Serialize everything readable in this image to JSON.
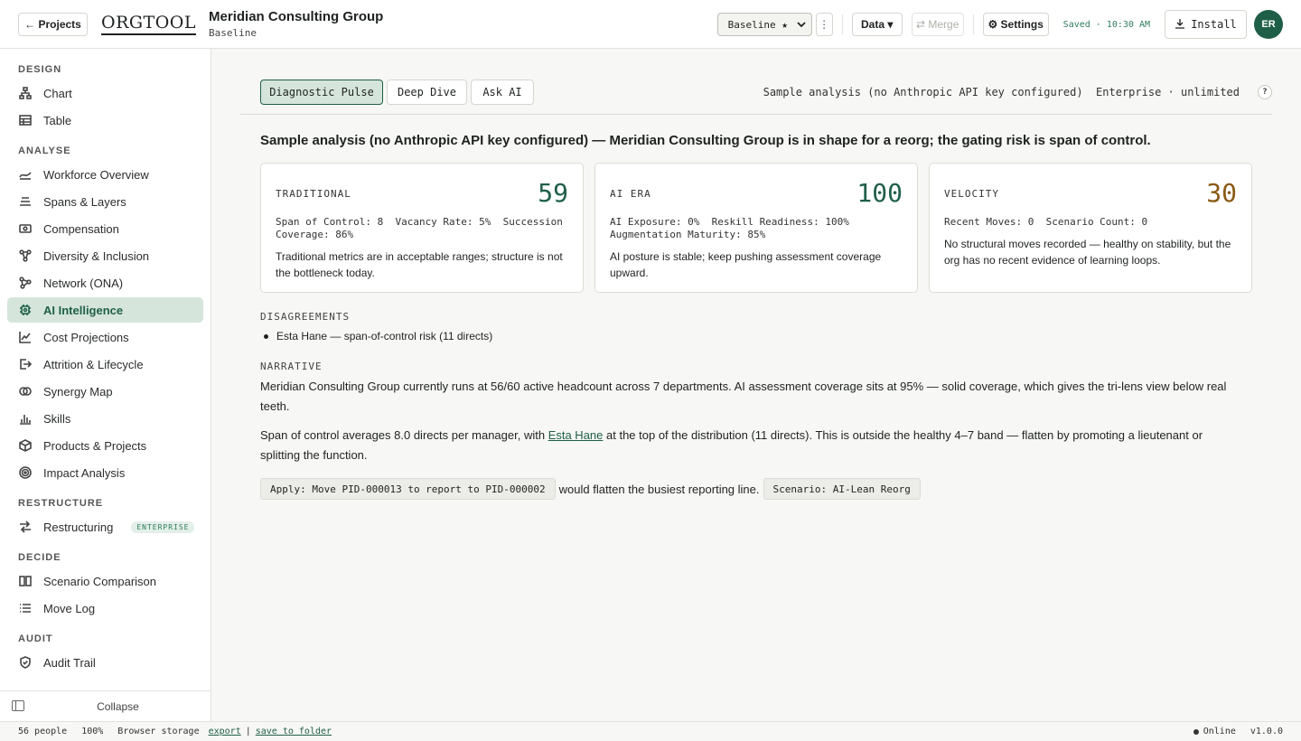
{
  "header": {
    "projects_label": "← Projects",
    "logo": "ORGTOOL",
    "org_name": "Meridian Consulting Group",
    "org_subtitle": "Baseline",
    "scenario_select": "Baseline ★",
    "kebab": "⋮",
    "data_label": "Data ▾",
    "merge_label": "⇄ Merge",
    "settings_label": "⚙ Settings",
    "saved_status": "Saved · 10:30 AM",
    "install_label": "Install",
    "avatar_initials": "ER"
  },
  "sidebar": {
    "sections": [
      {
        "label": "DESIGN",
        "items": [
          {
            "label": "Chart",
            "icon": "org-chart-icon"
          },
          {
            "label": "Table",
            "icon": "table-icon"
          }
        ]
      },
      {
        "label": "ANALYSE",
        "items": [
          {
            "label": "Workforce Overview",
            "icon": "trend-icon"
          },
          {
            "label": "Spans & Layers",
            "icon": "layers-icon"
          },
          {
            "label": "Compensation",
            "icon": "banknote-icon"
          },
          {
            "label": "Diversity & Inclusion",
            "icon": "people-icon"
          },
          {
            "label": "Network (ONA)",
            "icon": "network-icon"
          },
          {
            "label": "AI Intelligence",
            "icon": "chip-icon",
            "active": true
          },
          {
            "label": "Cost Projections",
            "icon": "line-chart-icon"
          },
          {
            "label": "Attrition & Lifecycle",
            "icon": "exit-icon"
          },
          {
            "label": "Synergy Map",
            "icon": "venn-icon"
          },
          {
            "label": "Skills",
            "icon": "bar-chart-icon"
          },
          {
            "label": "Products & Projects",
            "icon": "box-icon"
          },
          {
            "label": "Impact Analysis",
            "icon": "target-icon"
          }
        ]
      },
      {
        "label": "RESTRUCTURE",
        "items": [
          {
            "label": "Restructuring",
            "icon": "shuffle-icon",
            "badge": "ENTERPRISE"
          }
        ]
      },
      {
        "label": "DECIDE",
        "items": [
          {
            "label": "Scenario Comparison",
            "icon": "columns-icon"
          },
          {
            "label": "Move Log",
            "icon": "list-icon"
          }
        ]
      },
      {
        "label": "AUDIT",
        "items": [
          {
            "label": "Audit Trail",
            "icon": "shield-check-icon"
          }
        ]
      }
    ],
    "collapse_label": "Collapse"
  },
  "main": {
    "tabs": [
      {
        "label": "Diagnostic Pulse",
        "active": true
      },
      {
        "label": "Deep Dive"
      },
      {
        "label": "Ask AI"
      }
    ],
    "info_text": "Sample analysis (no Anthropic API key configured)  Enterprise · unlimited",
    "help": "?",
    "headline": "Sample analysis (no Anthropic API key configured) — Meridian Consulting Group is in shape for a reorg; the gating risk is span of control.",
    "cards": [
      {
        "label": "TRADITIONAL",
        "score": "59",
        "metrics": "Span of Control: 8  Vacancy Rate: 5%  Succession Coverage: 86%",
        "desc": "Traditional metrics are in acceptable ranges; structure is not the bottleneck today."
      },
      {
        "label": "AI ERA",
        "score": "100",
        "metrics": "AI Exposure: 0%  Reskill Readiness: 100%  Augmentation Maturity: 85%",
        "desc": "AI posture is stable; keep pushing assessment coverage upward."
      },
      {
        "label": "VELOCITY",
        "score": "30",
        "metrics": "Recent Moves: 0  Scenario Count: 0",
        "desc": "No structural moves recorded — healthy on stability, but the org has no recent evidence of learning loops."
      }
    ],
    "disagreements_label": "DISAGREEMENTS",
    "disagreements": [
      "Esta Hane — span-of-control risk (11 directs)"
    ],
    "narrative_label": "NARRATIVE",
    "narrative_1": "Meridian Consulting Group currently runs at 56/60 active headcount across 7 departments. AI assessment coverage sits at 95% — solid coverage, which gives the tri-lens view below real teeth.",
    "narrative_2_pre": "Span of control averages 8.0 directs per manager, with ",
    "narrative_2_link": "Esta Hane",
    "narrative_2_post": " at the top of the distribution (11 directs). This is outside the healthy 4–7 band — flatten by promoting a lieutenant or splitting the function.",
    "action_chip": "Apply: Move PID-000013 to report to PID-000002",
    "action_text": "would flatten the busiest reporting line.",
    "scenario_chip": "Scenario: AI-Lean Reorg"
  },
  "status": {
    "people": "56 people",
    "zoom": "100%",
    "storage": "Browser storage",
    "export": "export",
    "pipe": "|",
    "save_folder": "save to folder",
    "online": "Online",
    "version": "v1.0.0"
  },
  "colors": {
    "accent": "#1f5f48",
    "accent_light": "#d5e5dc",
    "amber": "#8a5a12"
  }
}
